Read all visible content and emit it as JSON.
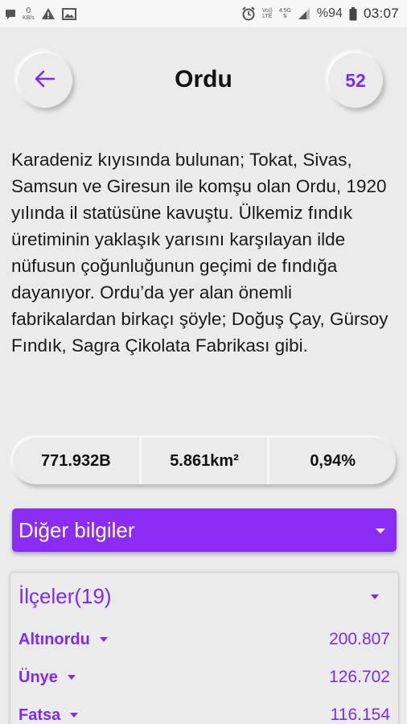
{
  "status_bar": {
    "data_speed_num": "0",
    "data_speed_unit": "KB/s",
    "network_top": "Vo))",
    "network_bottom": "LTE",
    "signal_top": "4.5G",
    "battery": "%94",
    "time": "03:07"
  },
  "header": {
    "title": "Ordu",
    "count": "52"
  },
  "description": "Karadeniz kıyısında bulunan; Tokat, Sivas, Samsun ve Giresun ile komşu olan Ordu, 1920 yılında il statüsüne kavuştu. Ülkemiz fındık üretiminin yaklaşık yarısını karşılayan ilde nüfusun çoğunluğunun geçimi de fındığa dayanıyor. Ordu’da yer alan önemli fabrikalardan birkaçı şöyle; Doğuş Çay, Gürsoy Fındık, Sagra Çikolata Fabrikası gibi.",
  "stats": {
    "population": "771.932B",
    "area": "5.861km²",
    "percent": "0,94%"
  },
  "other_info": {
    "label": "Diğer bilgiler"
  },
  "districts": {
    "title": "İlçeler(19)",
    "items": [
      {
        "name": "Altınordu",
        "value": "200.807"
      },
      {
        "name": "Ünye",
        "value": "126.702"
      },
      {
        "name": "Fatsa",
        "value": "116.154"
      }
    ]
  },
  "colors": {
    "accent": "#8b2cf5",
    "accent_text": "#7a2cf0",
    "background": "#ecebec"
  }
}
